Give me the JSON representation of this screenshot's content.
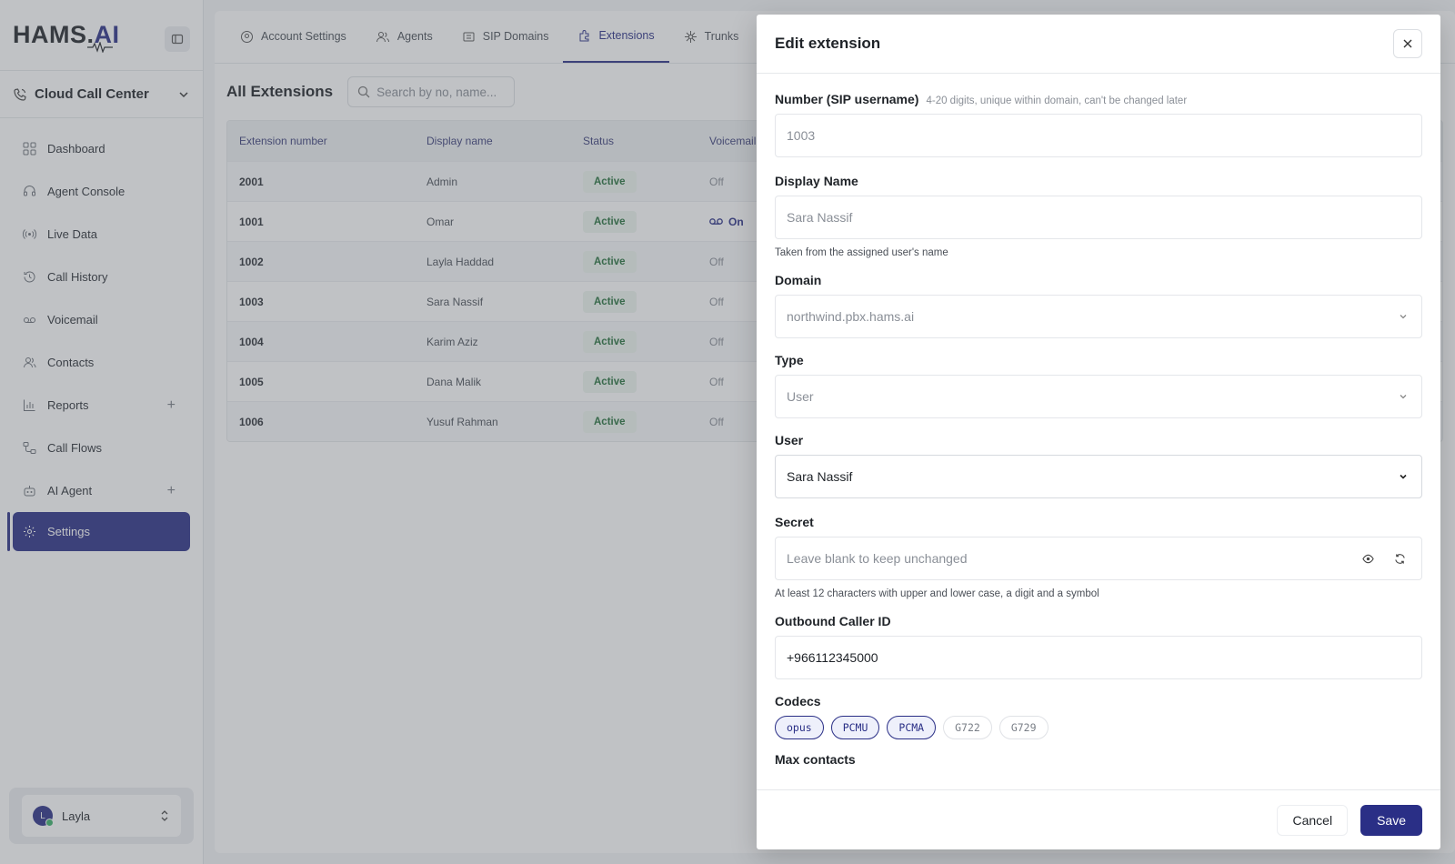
{
  "brand": {
    "logo_main": "HAMS.",
    "logo_accent": "AI"
  },
  "org": {
    "name": "Cloud Call Center"
  },
  "sidebar": {
    "items": [
      {
        "label": "Dashboard",
        "icon": "grid-icon"
      },
      {
        "label": "Agent Console",
        "icon": "headset-icon"
      },
      {
        "label": "Live Data",
        "icon": "broadcast-icon"
      },
      {
        "label": "Call History",
        "icon": "history-icon"
      },
      {
        "label": "Voicemail",
        "icon": "voicemail-icon"
      },
      {
        "label": "Contacts",
        "icon": "contacts-icon"
      },
      {
        "label": "Reports",
        "icon": "bar-chart-icon"
      },
      {
        "label": "Call Flows",
        "icon": "flow-icon"
      },
      {
        "label": "AI Agent",
        "icon": "robot-icon"
      },
      {
        "label": "Settings",
        "icon": "gear-icon"
      }
    ]
  },
  "user": {
    "initial": "L",
    "name": "Layla"
  },
  "tabs": [
    {
      "label": "Account Settings"
    },
    {
      "label": "Agents"
    },
    {
      "label": "SIP Domains"
    },
    {
      "label": "Extensions"
    },
    {
      "label": "Trunks"
    }
  ],
  "page": {
    "title": "All Extensions",
    "search_placeholder": "Search by no, name..."
  },
  "table": {
    "headers": [
      "Extension number",
      "Display name",
      "Status",
      "Voicemail"
    ],
    "rows": [
      {
        "number": "2001",
        "name": "Admin",
        "status": "Active",
        "voicemail": "Off"
      },
      {
        "number": "1001",
        "name": "Omar",
        "status": "Active",
        "voicemail": "On"
      },
      {
        "number": "1002",
        "name": "Layla Haddad",
        "status": "Active",
        "voicemail": "Off"
      },
      {
        "number": "1003",
        "name": "Sara Nassif",
        "status": "Active",
        "voicemail": "Off"
      },
      {
        "number": "1004",
        "name": "Karim Aziz",
        "status": "Active",
        "voicemail": "Off"
      },
      {
        "number": "1005",
        "name": "Dana Malik",
        "status": "Active",
        "voicemail": "Off"
      },
      {
        "number": "1006",
        "name": "Yusuf Rahman",
        "status": "Active",
        "voicemail": "Off"
      }
    ]
  },
  "drawer": {
    "title": "Edit extension",
    "number": {
      "label": "Number (SIP username)",
      "hint": "4-20 digits, unique within domain, can't be changed later",
      "value": "1003"
    },
    "display_name": {
      "label": "Display Name",
      "value": "Sara Nassif",
      "help": "Taken from the assigned user's name"
    },
    "domain": {
      "label": "Domain",
      "value": "northwind.pbx.hams.ai"
    },
    "type": {
      "label": "Type",
      "value": "User"
    },
    "user": {
      "label": "User",
      "value": "Sara Nassif"
    },
    "secret": {
      "label": "Secret",
      "placeholder": "Leave blank to keep unchanged",
      "help": "At least 12 characters with upper and lower case, a digit and a symbol"
    },
    "caller_id": {
      "label": "Outbound Caller ID",
      "value": "+966112345000"
    },
    "codecs": {
      "label": "Codecs",
      "items": [
        {
          "label": "opus",
          "selected": true
        },
        {
          "label": "PCMU",
          "selected": true
        },
        {
          "label": "PCMA",
          "selected": true
        },
        {
          "label": "G722",
          "selected": false
        },
        {
          "label": "G729",
          "selected": false
        }
      ]
    },
    "max_contacts": {
      "label": "Max contacts"
    },
    "cancel_label": "Cancel",
    "save_label": "Save"
  },
  "colors": {
    "accent": "#2a2f86",
    "active_badge_bg": "#eef5ef",
    "active_badge_text": "#25703b"
  }
}
